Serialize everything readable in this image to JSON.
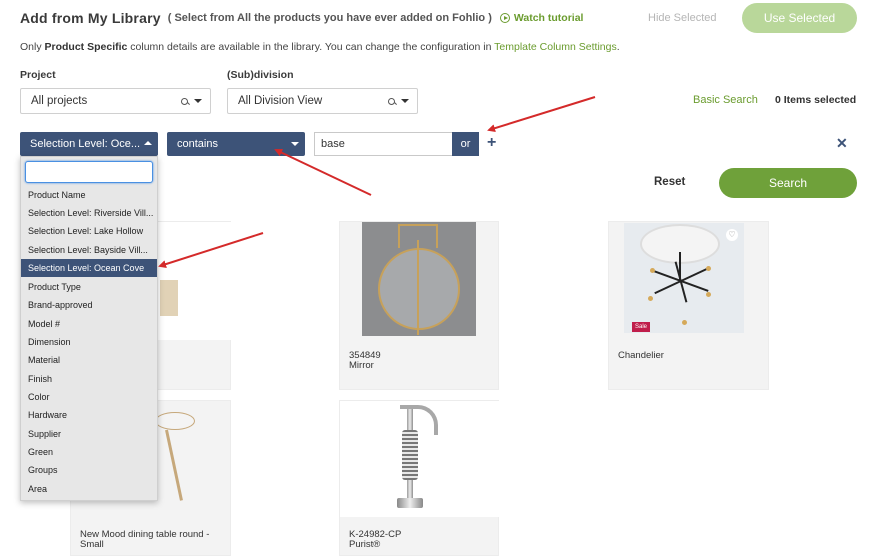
{
  "header": {
    "title": "Add from My Library",
    "subtitle": "( Select from All the products you have ever added on Fohlio )",
    "watch_tutorial": "Watch tutorial",
    "hide_selected": "Hide Selected",
    "use_selected": "Use Selected"
  },
  "info": {
    "prefix": "Only ",
    "bold": "Product Specific",
    "middle": " column details are available in the library. You can change the configuration in ",
    "link": "Template Column Settings",
    "suffix": "."
  },
  "filters": {
    "project_label": "Project",
    "project_value": "All projects",
    "subdivision_label": "(Sub)division",
    "subdivision_value": "All Division View",
    "basic_search": "Basic Search",
    "items_selected": "0 Items selected"
  },
  "query": {
    "field_value": "Selection Level: Oce...",
    "operator_value": "contains",
    "text_value": "base",
    "or_label": "or",
    "add_icon": "plus-icon",
    "close_icon": "close-icon",
    "reset": "Reset",
    "search": "Search"
  },
  "dropdown": {
    "items": [
      "Product Name",
      "Selection Level: Riverside Vill...",
      "Selection Level: Lake Hollow",
      "Selection Level: Bayside Vill...",
      "Selection Level: Ocean Cove",
      "Product Type",
      "Brand-approved",
      "Model #",
      "Dimension",
      "Material",
      "Finish",
      "Color",
      "Hardware",
      "Supplier",
      "Green",
      "Groups",
      "Area"
    ],
    "selected_index": 4
  },
  "products": [
    {
      "line1": "354849",
      "line2": "Mirror"
    },
    {
      "line1": "Chandelier",
      "line2": ""
    },
    {
      "line1": "New Mood dining table round -",
      "line2": "Small"
    },
    {
      "line1": "K-24982-CP",
      "line2": "Purist®"
    }
  ],
  "badges": {
    "sale": "Sale"
  },
  "colors": {
    "navy": "#3d5378",
    "green": "#6fa13a",
    "link_green": "#6b9c2f",
    "arrow_red": "#d42a2a"
  }
}
